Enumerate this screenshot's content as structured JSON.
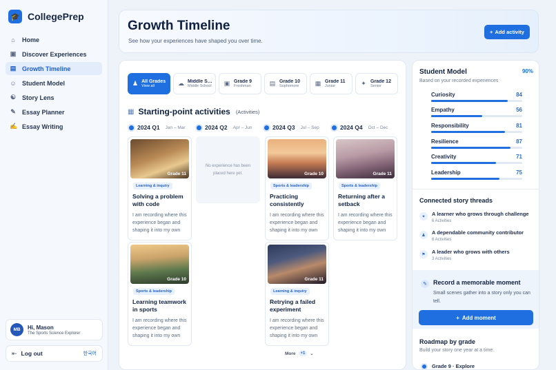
{
  "app": {
    "name": "CollegePrep"
  },
  "sidebar": {
    "items": [
      {
        "label": "Home",
        "icon": "home-icon"
      },
      {
        "label": "Discover Experiences",
        "icon": "image-icon"
      },
      {
        "label": "Growth Timeline",
        "icon": "calendar-icon",
        "active": true
      },
      {
        "label": "Student Model",
        "icon": "user-icon"
      },
      {
        "label": "Story Lens",
        "icon": "people-icon"
      },
      {
        "label": "Essay Planner",
        "icon": "pencil-icon"
      },
      {
        "label": "Essay Writing",
        "icon": "pen-icon"
      }
    ],
    "user": {
      "initials": "MB",
      "greeting": "Hi, Mason",
      "role": "The Sports Science Explorer"
    },
    "logout": "Log out",
    "language": "한국어"
  },
  "header": {
    "title": "Growth Timeline",
    "subtitle": "See how your experiences have shaped you over time.",
    "add_button": "Add activity"
  },
  "grade_tabs": [
    {
      "name": "All Grades",
      "sub": "View all",
      "active": true
    },
    {
      "name": "Middle School",
      "sub": "Middle School"
    },
    {
      "name": "Grade 9",
      "sub": "Freshman"
    },
    {
      "name": "Grade 10",
      "sub": "Sophomore"
    },
    {
      "name": "Grade 11",
      "sub": "Junior"
    },
    {
      "name": "Grade 12",
      "sub": "Senior"
    }
  ],
  "section": {
    "title": "Starting-point activities",
    "note": "(Activities)"
  },
  "quarters": [
    {
      "name": "2024 Q1",
      "range": "Jan – Mar"
    },
    {
      "name": "2024 Q2",
      "range": "Apr – Jun"
    },
    {
      "name": "2024 Q3",
      "range": "Jul – Sep"
    },
    {
      "name": "2024 Q4",
      "range": "Oct – Dec"
    }
  ],
  "cards": [
    {
      "grade": "Grade 11",
      "tag": "Learning & inquiry",
      "title": "Solving a problem with code",
      "body": "I am recording where this experience began and shaping it into my own story."
    },
    {
      "grade": "Grade 10",
      "tag": "Sports & leadership",
      "title": "Practicing consistently",
      "body": "I am recording where this experience began and shaping it into my own story."
    },
    {
      "grade": "Grade 11",
      "tag": "Sports & leadership",
      "title": "Returning after a setback",
      "body": "I am recording where this experience began and shaping it into my own story."
    },
    {
      "grade": "Grade 10",
      "tag": "Sports & leadership",
      "title": "Learning teamwork in sports",
      "body": "I am recording where this experience began and shaping it into my own story."
    },
    {
      "grade": "Grade 11",
      "tag": "Learning & inquiry",
      "title": "Retrying a failed experiment",
      "body": "I am recording where this experience began and shaping it into my own story."
    }
  ],
  "empty_quarter": "No experience has been placed here yet.",
  "more": {
    "label": "More",
    "count": "+1"
  },
  "student_model": {
    "title": "Student Model",
    "score": "90%",
    "subtitle": "Based on your recorded experiences",
    "traits": [
      {
        "name": "Curiosity",
        "value": 84
      },
      {
        "name": "Empathy",
        "value": 56
      },
      {
        "name": "Responsibility",
        "value": 81
      },
      {
        "name": "Resilience",
        "value": 87
      },
      {
        "name": "Creativity",
        "value": 71
      },
      {
        "name": "Leadership",
        "value": 75
      }
    ]
  },
  "threads": {
    "title": "Connected story threads",
    "items": [
      {
        "name": "A learner who grows through challenge",
        "count": "6 Activities"
      },
      {
        "name": "A dependable community contributor",
        "count": "6 Activities"
      },
      {
        "name": "A leader who grows with others",
        "count": "3 Activities"
      }
    ]
  },
  "record": {
    "title": "Record a memorable moment",
    "body": "Small scenes gather into a story only you can tell.",
    "button": "Add moment"
  },
  "roadmap": {
    "title": "Roadmap by grade",
    "subtitle": "Build your story one year at a time.",
    "first": "Grade 9 · Explore"
  },
  "colors": {
    "accent": "#1f6fe0",
    "tag_bg": "#e7f0fd"
  }
}
